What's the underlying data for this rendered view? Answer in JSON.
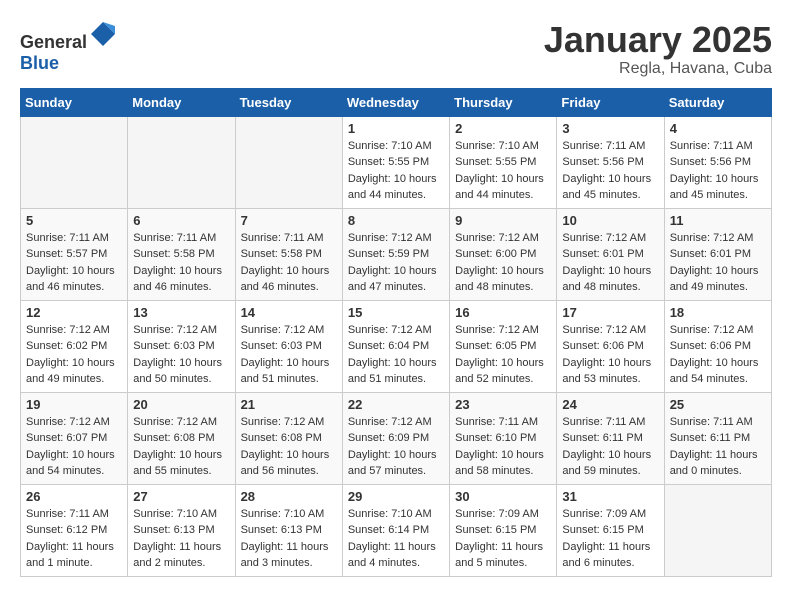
{
  "header": {
    "logo_general": "General",
    "logo_blue": "Blue",
    "title": "January 2025",
    "location": "Regla, Havana, Cuba"
  },
  "days_of_week": [
    "Sunday",
    "Monday",
    "Tuesday",
    "Wednesday",
    "Thursday",
    "Friday",
    "Saturday"
  ],
  "weeks": [
    [
      {
        "day": "",
        "empty": true
      },
      {
        "day": "",
        "empty": true
      },
      {
        "day": "",
        "empty": true
      },
      {
        "day": "1",
        "sunrise": "7:10 AM",
        "sunset": "5:55 PM",
        "daylight": "10 hours and 44 minutes."
      },
      {
        "day": "2",
        "sunrise": "7:10 AM",
        "sunset": "5:55 PM",
        "daylight": "10 hours and 44 minutes."
      },
      {
        "day": "3",
        "sunrise": "7:11 AM",
        "sunset": "5:56 PM",
        "daylight": "10 hours and 45 minutes."
      },
      {
        "day": "4",
        "sunrise": "7:11 AM",
        "sunset": "5:56 PM",
        "daylight": "10 hours and 45 minutes."
      }
    ],
    [
      {
        "day": "5",
        "sunrise": "7:11 AM",
        "sunset": "5:57 PM",
        "daylight": "10 hours and 46 minutes."
      },
      {
        "day": "6",
        "sunrise": "7:11 AM",
        "sunset": "5:58 PM",
        "daylight": "10 hours and 46 minutes."
      },
      {
        "day": "7",
        "sunrise": "7:11 AM",
        "sunset": "5:58 PM",
        "daylight": "10 hours and 46 minutes."
      },
      {
        "day": "8",
        "sunrise": "7:12 AM",
        "sunset": "5:59 PM",
        "daylight": "10 hours and 47 minutes."
      },
      {
        "day": "9",
        "sunrise": "7:12 AM",
        "sunset": "6:00 PM",
        "daylight": "10 hours and 48 minutes."
      },
      {
        "day": "10",
        "sunrise": "7:12 AM",
        "sunset": "6:01 PM",
        "daylight": "10 hours and 48 minutes."
      },
      {
        "day": "11",
        "sunrise": "7:12 AM",
        "sunset": "6:01 PM",
        "daylight": "10 hours and 49 minutes."
      }
    ],
    [
      {
        "day": "12",
        "sunrise": "7:12 AM",
        "sunset": "6:02 PM",
        "daylight": "10 hours and 49 minutes."
      },
      {
        "day": "13",
        "sunrise": "7:12 AM",
        "sunset": "6:03 PM",
        "daylight": "10 hours and 50 minutes."
      },
      {
        "day": "14",
        "sunrise": "7:12 AM",
        "sunset": "6:03 PM",
        "daylight": "10 hours and 51 minutes."
      },
      {
        "day": "15",
        "sunrise": "7:12 AM",
        "sunset": "6:04 PM",
        "daylight": "10 hours and 51 minutes."
      },
      {
        "day": "16",
        "sunrise": "7:12 AM",
        "sunset": "6:05 PM",
        "daylight": "10 hours and 52 minutes."
      },
      {
        "day": "17",
        "sunrise": "7:12 AM",
        "sunset": "6:06 PM",
        "daylight": "10 hours and 53 minutes."
      },
      {
        "day": "18",
        "sunrise": "7:12 AM",
        "sunset": "6:06 PM",
        "daylight": "10 hours and 54 minutes."
      }
    ],
    [
      {
        "day": "19",
        "sunrise": "7:12 AM",
        "sunset": "6:07 PM",
        "daylight": "10 hours and 54 minutes."
      },
      {
        "day": "20",
        "sunrise": "7:12 AM",
        "sunset": "6:08 PM",
        "daylight": "10 hours and 55 minutes."
      },
      {
        "day": "21",
        "sunrise": "7:12 AM",
        "sunset": "6:08 PM",
        "daylight": "10 hours and 56 minutes."
      },
      {
        "day": "22",
        "sunrise": "7:12 AM",
        "sunset": "6:09 PM",
        "daylight": "10 hours and 57 minutes."
      },
      {
        "day": "23",
        "sunrise": "7:11 AM",
        "sunset": "6:10 PM",
        "daylight": "10 hours and 58 minutes."
      },
      {
        "day": "24",
        "sunrise": "7:11 AM",
        "sunset": "6:11 PM",
        "daylight": "10 hours and 59 minutes."
      },
      {
        "day": "25",
        "sunrise": "7:11 AM",
        "sunset": "6:11 PM",
        "daylight": "11 hours and 0 minutes."
      }
    ],
    [
      {
        "day": "26",
        "sunrise": "7:11 AM",
        "sunset": "6:12 PM",
        "daylight": "11 hours and 1 minute."
      },
      {
        "day": "27",
        "sunrise": "7:10 AM",
        "sunset": "6:13 PM",
        "daylight": "11 hours and 2 minutes."
      },
      {
        "day": "28",
        "sunrise": "7:10 AM",
        "sunset": "6:13 PM",
        "daylight": "11 hours and 3 minutes."
      },
      {
        "day": "29",
        "sunrise": "7:10 AM",
        "sunset": "6:14 PM",
        "daylight": "11 hours and 4 minutes."
      },
      {
        "day": "30",
        "sunrise": "7:09 AM",
        "sunset": "6:15 PM",
        "daylight": "11 hours and 5 minutes."
      },
      {
        "day": "31",
        "sunrise": "7:09 AM",
        "sunset": "6:15 PM",
        "daylight": "11 hours and 6 minutes."
      },
      {
        "day": "",
        "empty": true
      }
    ]
  ],
  "labels": {
    "sunrise_prefix": "Sunrise: ",
    "sunset_prefix": "Sunset: ",
    "daylight_label": "Daylight: "
  }
}
